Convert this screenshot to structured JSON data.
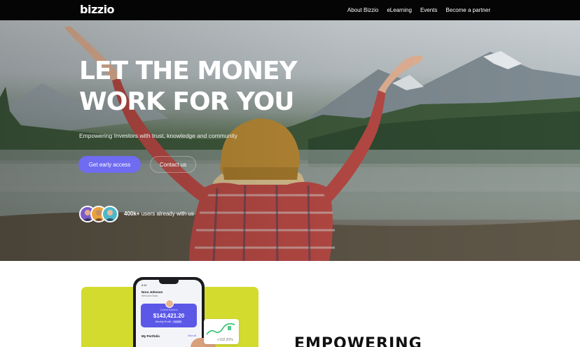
{
  "brand": {
    "logo": "bizzio"
  },
  "nav": {
    "items": [
      {
        "label": "About Bizzio"
      },
      {
        "label": "eLearning"
      },
      {
        "label": "Events"
      },
      {
        "label": "Become a partner"
      }
    ]
  },
  "hero": {
    "title_line1": "LET THE MONEY",
    "title_line2": "WORK FOR YOU",
    "subtitle": "Empowering Investors with trust, knowledge and community",
    "primary_cta": "Get early access",
    "secondary_cta": "Contact us",
    "users_count": "400k+",
    "users_text": " users already with us"
  },
  "app_preview": {
    "time": "9:41",
    "user_name": "Nora Johnson",
    "welcome": "Welcome Back",
    "balance_label": "Current Balance",
    "balance_value": "$143,421.20",
    "weekly_label": "Weekly Profit",
    "weekly_value": "+4.5%",
    "portfolio_label": "My Portfolio",
    "view_all": "View all",
    "chart_value": "+102.20%"
  },
  "section2": {
    "heading": "EMPOWERING"
  },
  "colors": {
    "accent": "#6f6cf2",
    "lime": "#d3dc2e",
    "nav_bg": "#050505"
  }
}
